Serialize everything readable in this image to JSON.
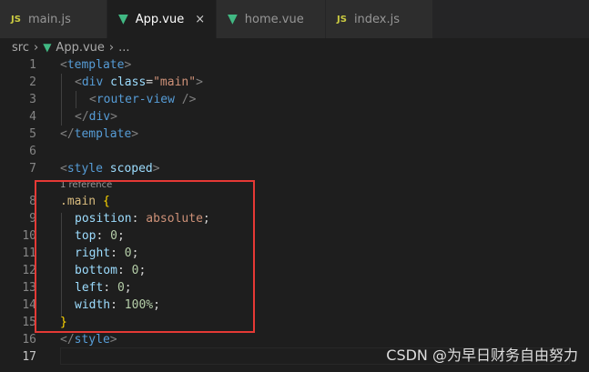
{
  "tabs": [
    {
      "icon": "JS",
      "label": "main.js",
      "active": false
    },
    {
      "icon": "vue-icon",
      "label": "App.vue",
      "active": true
    },
    {
      "icon": "vue-icon",
      "label": "home.vue",
      "active": false
    },
    {
      "icon": "JS",
      "label": "index.js",
      "active": false
    }
  ],
  "tab_close_glyph": "×",
  "breadcrumb": {
    "folder": "src",
    "file": "App.vue",
    "more": "..."
  },
  "line_numbers": [
    "1",
    "2",
    "3",
    "4",
    "5",
    "6",
    "7",
    "8",
    "9",
    "10",
    "11",
    "12",
    "13",
    "14",
    "15",
    "16",
    "17"
  ],
  "reference_lens": "1 reference",
  "code": {
    "l1": {
      "open": "<",
      "tag": "template",
      "close": ">"
    },
    "l2": {
      "open": "<",
      "tag": "div",
      "attr": "class",
      "eq": "=",
      "value": "\"main\"",
      "close": ">"
    },
    "l3": {
      "open": "<",
      "tag": "router-view",
      "close": " />"
    },
    "l4": {
      "open": "</",
      "tag": "div",
      "close": ">"
    },
    "l5": {
      "open": "</",
      "tag": "template",
      "close": ">"
    },
    "l7": {
      "open": "<",
      "tag": "style",
      "attr": "scoped",
      "close": ">"
    },
    "l8": {
      "selector": ".main",
      "brace": "{"
    },
    "l9": {
      "prop": "position",
      "value": "absolute"
    },
    "l10": {
      "prop": "top",
      "value": "0"
    },
    "l11": {
      "prop": "right",
      "value": "0"
    },
    "l12": {
      "prop": "bottom",
      "value": "0"
    },
    "l13": {
      "prop": "left",
      "value": "0"
    },
    "l14": {
      "prop": "width",
      "value": "100%"
    },
    "l15": {
      "brace": "}"
    },
    "l16": {
      "open": "</",
      "tag": "style",
      "close": ">"
    }
  },
  "watermark": "CSDN @为早日财务自由努力",
  "colors": {
    "accent_highlight": "#e53935",
    "vue_green": "#41b883",
    "js_yellow": "#cbcb41"
  }
}
